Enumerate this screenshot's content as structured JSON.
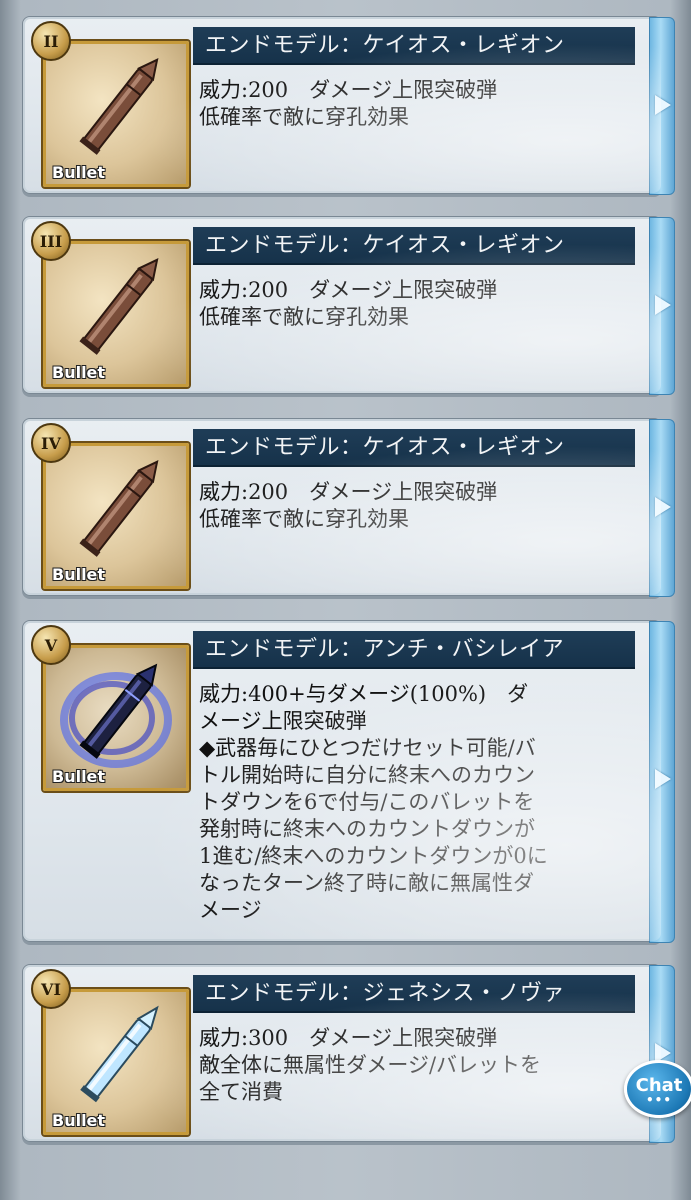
{
  "cards": [
    {
      "numeral": "II",
      "title": "エンドモデル：ケイオス・レギオン",
      "icon": "bullet-copper-icon",
      "icon_label": "Bullet",
      "desc_lines": [
        "威力:200　ダメージ上限突破弾",
        "低確率で敵に穿孔効果"
      ]
    },
    {
      "numeral": "III",
      "title": "エンドモデル：ケイオス・レギオン",
      "icon": "bullet-copper-icon",
      "icon_label": "Bullet",
      "desc_lines": [
        "威力:200　ダメージ上限突破弾",
        "低確率で敵に穿孔効果"
      ]
    },
    {
      "numeral": "IV",
      "title": "エンドモデル：ケイオス・レギオン",
      "icon": "bullet-copper-icon",
      "icon_label": "Bullet",
      "desc_lines": [
        "威力:200　ダメージ上限突破弾",
        "低確率で敵に穿孔効果"
      ]
    },
    {
      "numeral": "V",
      "title": "エンドモデル：アンチ・バシレイア",
      "icon": "bullet-blue-flame-icon",
      "icon_label": "Bullet",
      "desc_lines": [
        "威力:400+与ダメージ(100%)　ダ",
        "メージ上限突破弾",
        "◆武器毎にひとつだけセット可能/バ",
        "トル開始時に自分に終末へのカウン",
        "トダウンを6で付与/このバレットを",
        "発射時に終末へのカウントダウンが",
        "1進む/終末へのカウントダウンが0に",
        "なったターン終了時に敵に無属性ダ",
        "メージ"
      ]
    },
    {
      "numeral": "VI",
      "title": "エンドモデル：ジェネシス・ノヴァ",
      "icon": "bullet-silver-icon",
      "icon_label": "Bullet",
      "desc_lines": [
        "威力:300　ダメージ上限突破弾",
        "敵全体に無属性ダメージ/バレットを",
        "全て消費"
      ]
    }
  ],
  "chat": {
    "label": "Chat",
    "dots": "•••"
  }
}
